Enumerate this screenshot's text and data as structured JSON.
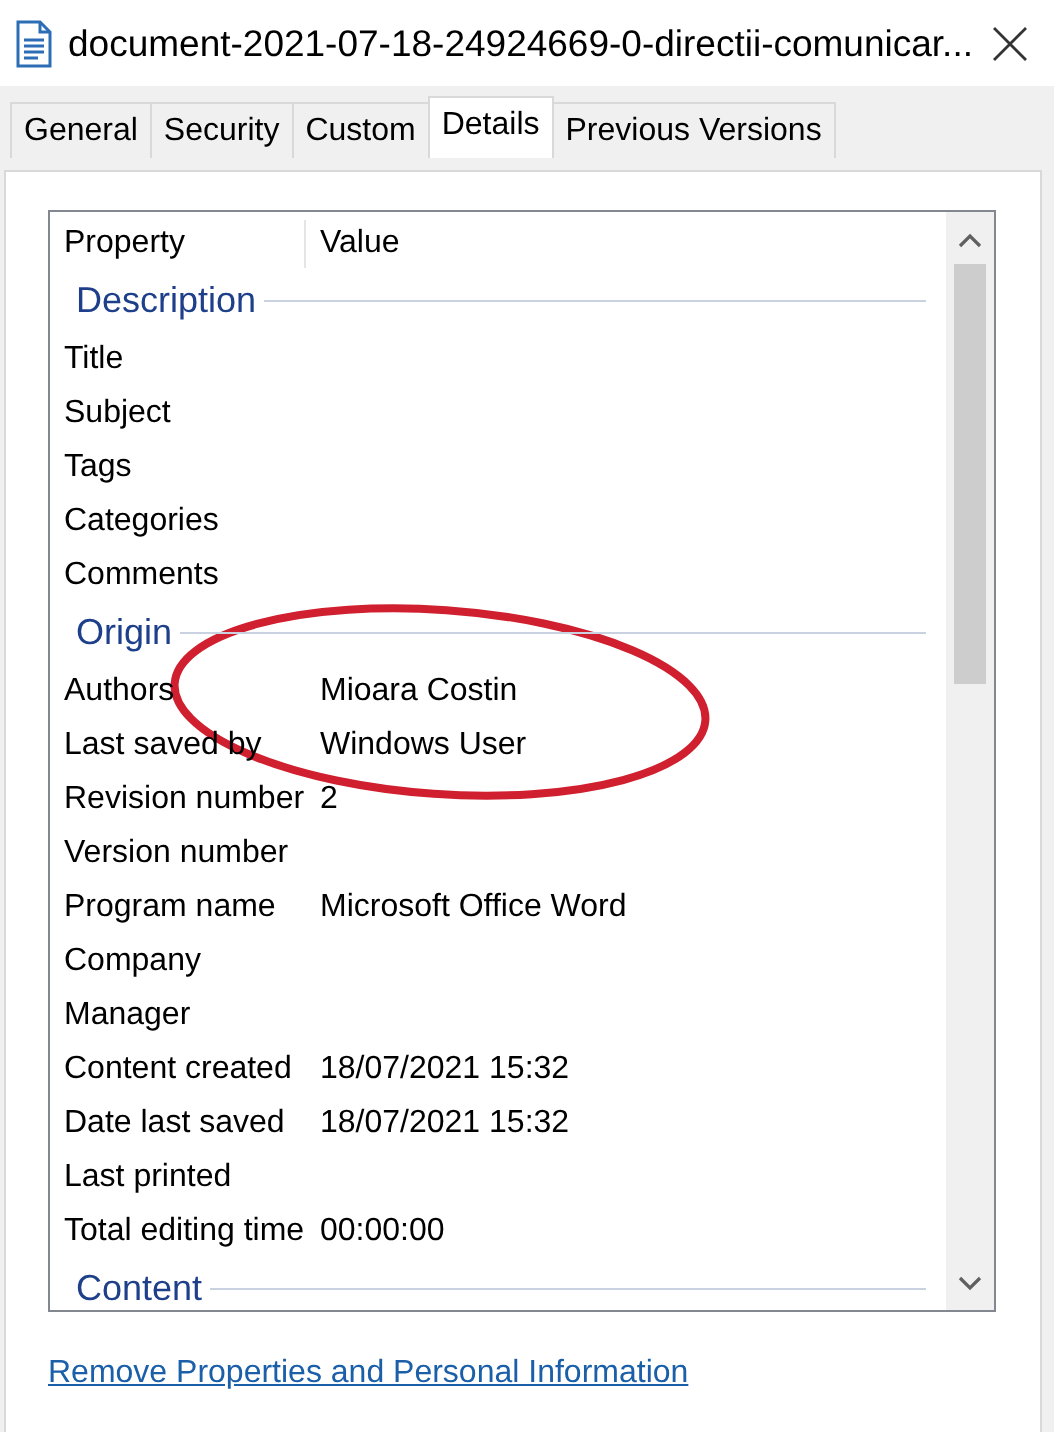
{
  "window": {
    "title": "document-2021-07-18-24924669-0-directii-comunicar..."
  },
  "tabs": [
    {
      "label": "General",
      "selected": false
    },
    {
      "label": "Security",
      "selected": false
    },
    {
      "label": "Custom",
      "selected": false
    },
    {
      "label": "Details",
      "selected": true
    },
    {
      "label": "Previous Versions",
      "selected": false
    }
  ],
  "properties": {
    "columns": [
      "Property",
      "Value"
    ],
    "sections": [
      {
        "title": "Description",
        "rows": [
          {
            "property": "Title"
          },
          {
            "property": "Subject"
          },
          {
            "property": "Tags"
          },
          {
            "property": "Categories"
          },
          {
            "property": "Comments"
          }
        ]
      },
      {
        "title": "Origin",
        "rows": [
          {
            "property": "Authors",
            "value": "Mioara Costin"
          },
          {
            "property": "Last saved by",
            "value": "Windows User"
          },
          {
            "property": "Revision number",
            "value": "2"
          },
          {
            "property": "Version number"
          },
          {
            "property": "Program name",
            "value": "Microsoft Office Word"
          },
          {
            "property": "Company"
          },
          {
            "property": "Manager"
          },
          {
            "property": "Content created",
            "value": "18/07/2021 15:32"
          },
          {
            "property": "Date last saved",
            "value": "18/07/2021 15:32"
          },
          {
            "property": "Last printed"
          },
          {
            "property": "Total editing time",
            "value": "00:00:00"
          }
        ]
      },
      {
        "title": "Content"
      }
    ]
  },
  "link": "Remove Properties and Personal Information"
}
